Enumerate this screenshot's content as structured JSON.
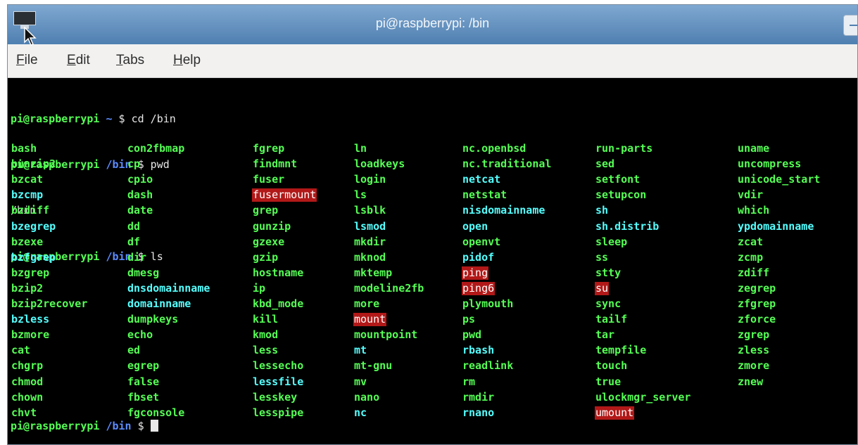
{
  "window": {
    "title": "pi@raspberrypi: /bin"
  },
  "menubar": {
    "items": [
      {
        "label": "File",
        "u": "F",
        "rest": "ile"
      },
      {
        "label": "Edit",
        "u": "E",
        "rest": "dit"
      },
      {
        "label": "Tabs",
        "u": "T",
        "rest": "abs"
      },
      {
        "label": "Help",
        "u": "H",
        "rest": "elp"
      }
    ]
  },
  "terminal": {
    "lines": [
      {
        "user": "pi@raspberrypi",
        "path": "~",
        "cmd": "$ cd /bin"
      },
      {
        "user": "pi@raspberrypi",
        "path": "/bin",
        "cmd": "$ pwd"
      },
      {
        "output": "/bin"
      },
      {
        "user": "pi@raspberrypi",
        "path": "/bin",
        "cmd": "$ ls"
      }
    ],
    "ls_columns": [
      [
        [
          "bash",
          "exec"
        ],
        [
          "bunzip2",
          "exec"
        ],
        [
          "bzcat",
          "exec"
        ],
        [
          "bzcmp",
          "link"
        ],
        [
          "bzdiff",
          "exec"
        ],
        [
          "bzegrep",
          "link"
        ],
        [
          "bzexe",
          "exec"
        ],
        [
          "bzfgrep",
          "link"
        ],
        [
          "bzgrep",
          "exec"
        ],
        [
          "bzip2",
          "exec"
        ],
        [
          "bzip2recover",
          "exec"
        ],
        [
          "bzless",
          "link"
        ],
        [
          "bzmore",
          "exec"
        ],
        [
          "cat",
          "exec"
        ],
        [
          "chgrp",
          "exec"
        ],
        [
          "chmod",
          "exec"
        ],
        [
          "chown",
          "exec"
        ],
        [
          "chvt",
          "exec"
        ]
      ],
      [
        [
          "con2fbmap",
          "exec"
        ],
        [
          "cp",
          "exec"
        ],
        [
          "cpio",
          "exec"
        ],
        [
          "dash",
          "exec"
        ],
        [
          "date",
          "exec"
        ],
        [
          "dd",
          "exec"
        ],
        [
          "df",
          "exec"
        ],
        [
          "dir",
          "exec"
        ],
        [
          "dmesg",
          "exec"
        ],
        [
          "dnsdomainname",
          "link"
        ],
        [
          "domainname",
          "link"
        ],
        [
          "dumpkeys",
          "exec"
        ],
        [
          "echo",
          "exec"
        ],
        [
          "ed",
          "exec"
        ],
        [
          "egrep",
          "exec"
        ],
        [
          "false",
          "exec"
        ],
        [
          "fbset",
          "exec"
        ],
        [
          "fgconsole",
          "exec"
        ]
      ],
      [
        [
          "fgrep",
          "exec"
        ],
        [
          "findmnt",
          "exec"
        ],
        [
          "fuser",
          "exec"
        ],
        [
          "fusermount",
          "suid"
        ],
        [
          "grep",
          "exec"
        ],
        [
          "gunzip",
          "exec"
        ],
        [
          "gzexe",
          "exec"
        ],
        [
          "gzip",
          "exec"
        ],
        [
          "hostname",
          "exec"
        ],
        [
          "ip",
          "exec"
        ],
        [
          "kbd_mode",
          "exec"
        ],
        [
          "kill",
          "exec"
        ],
        [
          "kmod",
          "exec"
        ],
        [
          "less",
          "exec"
        ],
        [
          "lessecho",
          "exec"
        ],
        [
          "lessfile",
          "link"
        ],
        [
          "lesskey",
          "exec"
        ],
        [
          "lesspipe",
          "exec"
        ]
      ],
      [
        [
          "ln",
          "exec"
        ],
        [
          "loadkeys",
          "exec"
        ],
        [
          "login",
          "exec"
        ],
        [
          "ls",
          "exec"
        ],
        [
          "lsblk",
          "exec"
        ],
        [
          "lsmod",
          "link"
        ],
        [
          "mkdir",
          "exec"
        ],
        [
          "mknod",
          "exec"
        ],
        [
          "mktemp",
          "exec"
        ],
        [
          "modeline2fb",
          "exec"
        ],
        [
          "more",
          "exec"
        ],
        [
          "mount",
          "suid"
        ],
        [
          "mountpoint",
          "exec"
        ],
        [
          "mt",
          "link"
        ],
        [
          "mt-gnu",
          "exec"
        ],
        [
          "mv",
          "exec"
        ],
        [
          "nano",
          "exec"
        ],
        [
          "nc",
          "link"
        ]
      ],
      [
        [
          "nc.openbsd",
          "exec"
        ],
        [
          "nc.traditional",
          "exec"
        ],
        [
          "netcat",
          "link"
        ],
        [
          "netstat",
          "exec"
        ],
        [
          "nisdomainname",
          "link"
        ],
        [
          "open",
          "link"
        ],
        [
          "openvt",
          "exec"
        ],
        [
          "pidof",
          "link"
        ],
        [
          "ping",
          "suid"
        ],
        [
          "ping6",
          "suid"
        ],
        [
          "plymouth",
          "exec"
        ],
        [
          "ps",
          "exec"
        ],
        [
          "pwd",
          "exec"
        ],
        [
          "rbash",
          "link"
        ],
        [
          "readlink",
          "exec"
        ],
        [
          "rm",
          "exec"
        ],
        [
          "rmdir",
          "exec"
        ],
        [
          "rnano",
          "link"
        ]
      ],
      [
        [
          "run-parts",
          "exec"
        ],
        [
          "sed",
          "exec"
        ],
        [
          "setfont",
          "exec"
        ],
        [
          "setupcon",
          "exec"
        ],
        [
          "sh",
          "link"
        ],
        [
          "sh.distrib",
          "link"
        ],
        [
          "sleep",
          "exec"
        ],
        [
          "ss",
          "exec"
        ],
        [
          "stty",
          "exec"
        ],
        [
          "su",
          "suid"
        ],
        [
          "sync",
          "exec"
        ],
        [
          "tailf",
          "exec"
        ],
        [
          "tar",
          "exec"
        ],
        [
          "tempfile",
          "exec"
        ],
        [
          "touch",
          "exec"
        ],
        [
          "true",
          "exec"
        ],
        [
          "ulockmgr_server",
          "exec"
        ],
        [
          "umount",
          "suid"
        ]
      ],
      [
        [
          "uname",
          "exec"
        ],
        [
          "uncompress",
          "exec"
        ],
        [
          "unicode_start",
          "exec"
        ],
        [
          "vdir",
          "exec"
        ],
        [
          "which",
          "exec"
        ],
        [
          "ypdomainname",
          "link"
        ],
        [
          "zcat",
          "exec"
        ],
        [
          "zcmp",
          "exec"
        ],
        [
          "zdiff",
          "exec"
        ],
        [
          "zegrep",
          "exec"
        ],
        [
          "zfgrep",
          "exec"
        ],
        [
          "zforce",
          "exec"
        ],
        [
          "zgrep",
          "exec"
        ],
        [
          "zless",
          "exec"
        ],
        [
          "zmore",
          "exec"
        ],
        [
          "znew",
          "exec"
        ]
      ]
    ],
    "final_prompt": {
      "user": "pi@raspberrypi",
      "path": "/bin",
      "cmd": "$"
    }
  },
  "colors": {
    "exec": "#55ff55",
    "link": "#55ffff",
    "suid_bg": "#b21818",
    "titlebar": "#6693c2"
  },
  "icons": {
    "app": "terminal-app-icon",
    "cursor": "mouse-pointer-icon"
  }
}
